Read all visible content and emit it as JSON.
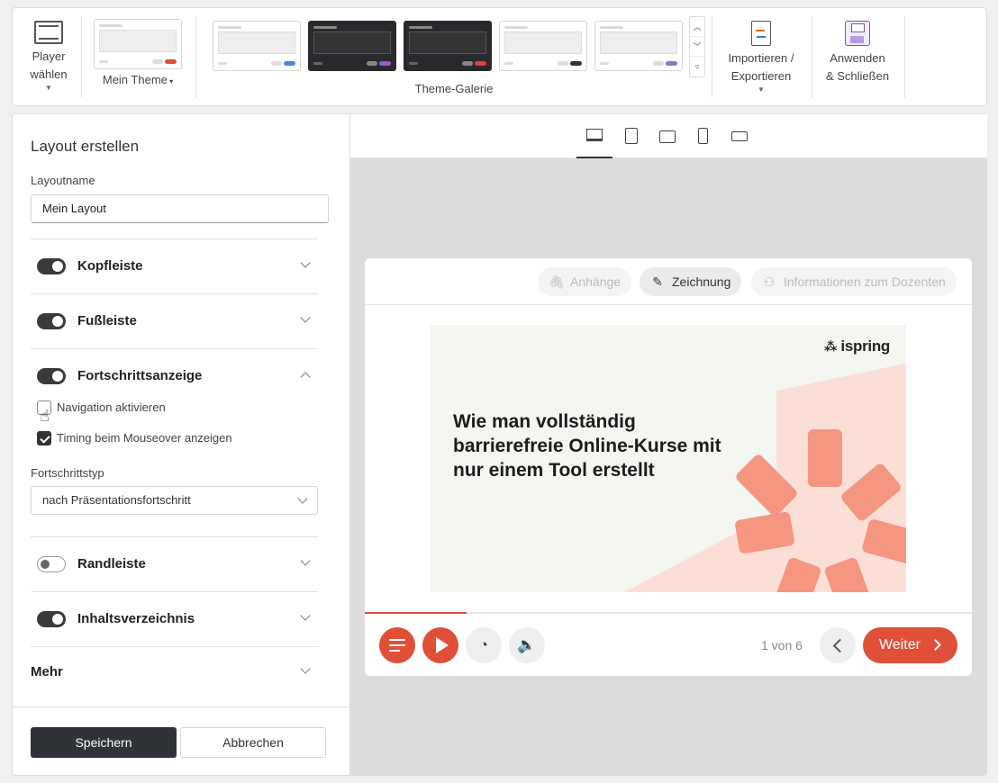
{
  "ribbon": {
    "player_label_1": "Player",
    "player_label_2": "wählen",
    "my_theme_label": "Mein Theme",
    "gallery_label": "Theme-Galerie",
    "gallery_themes": [
      {
        "style": "light",
        "accent": "#4a86d8"
      },
      {
        "style": "dark",
        "accent": "#9b59d0"
      },
      {
        "style": "dark",
        "accent": "#e04040"
      },
      {
        "style": "light",
        "accent": "#333333"
      },
      {
        "style": "light",
        "accent": "#9b6ad8"
      }
    ],
    "import_label_1": "Importieren /",
    "import_label_2": "Exportieren",
    "apply_label_1": "Anwenden",
    "apply_label_2": "& Schließen"
  },
  "panel": {
    "title": "Layout erstellen",
    "layout_name_label": "Layoutname",
    "layout_name_value": "Mein Layout",
    "sections": {
      "header": {
        "label": "Kopfleiste",
        "enabled": true
      },
      "footer": {
        "label": "Fußleiste",
        "enabled": true
      },
      "progress": {
        "label": "Fortschrittsanzeige",
        "enabled": true
      },
      "sidebar": {
        "label": "Randleiste",
        "enabled": false
      },
      "toc": {
        "label": "Inhaltsverzeichnis",
        "enabled": true
      },
      "more": {
        "label": "Mehr"
      }
    },
    "checkbox_navigation": {
      "label": "Navigation aktivieren",
      "checked": false
    },
    "checkbox_timing": {
      "label": "Timing beim Mouseover anzeigen",
      "checked": true
    },
    "progress_type_label": "Fortschrittstyp",
    "progress_type_value": "nach Präsentationsfortschritt",
    "save_label": "Speichern",
    "cancel_label": "Abbrechen"
  },
  "preview": {
    "chips": {
      "attachments": "Anhänge",
      "drawing": "Zeichnung",
      "presenter_info": "Informationen zum Dozenten"
    },
    "slide": {
      "logo": "ispring",
      "headline": "Wie man vollständig barrierefreie Online-Kurse mit nur einem Tool erstellt"
    },
    "progress_fraction": 0.167,
    "page_count": "1 von 6",
    "next_label": "Weiter",
    "accent_color": "#e04f38"
  }
}
